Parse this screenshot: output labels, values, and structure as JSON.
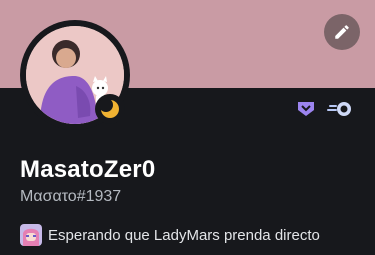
{
  "profile": {
    "display_name": "MasatoZer0",
    "tag": "Μασατο#1937",
    "status": "idle",
    "custom_status": {
      "text": "Esperando que LadyMars prenda directo",
      "emoji": "custom-emoji"
    },
    "badges": [
      "hypesquad-bravery-icon",
      "nitro-boost-icon"
    ],
    "banner_color": "#c99ba4",
    "edit_icon": "pencil-icon"
  }
}
